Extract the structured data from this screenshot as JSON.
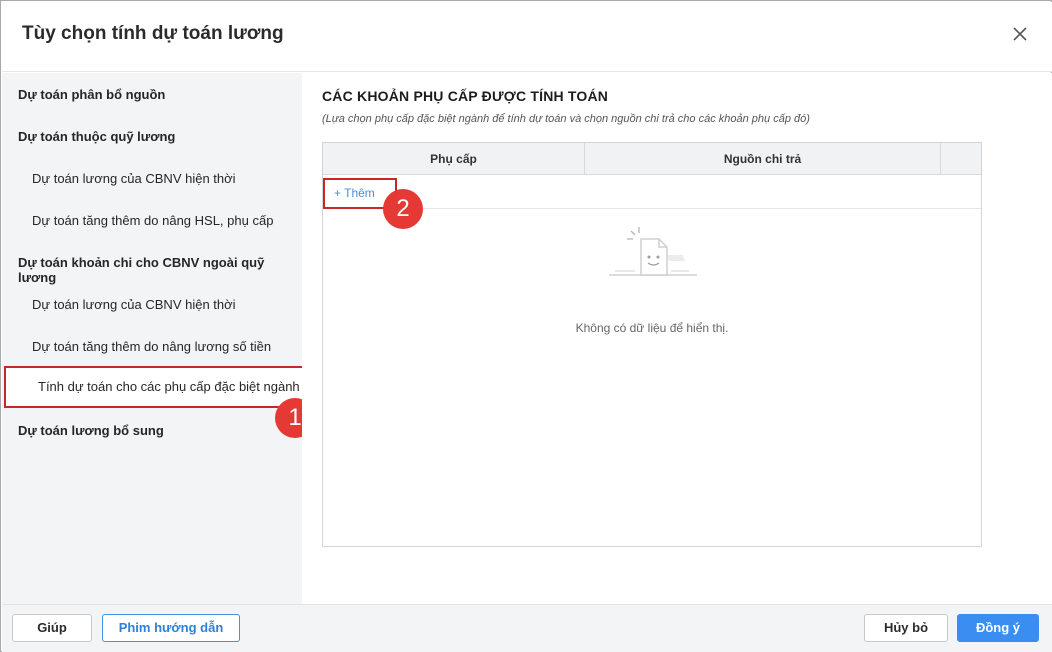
{
  "dialog": {
    "title": "Tùy chọn tính dự toán lương"
  },
  "sidebar": {
    "items": [
      {
        "label": "Dự toán phân bổ nguồn"
      },
      {
        "label": "Dự toán thuộc quỹ lương"
      },
      {
        "label": "Dự toán lương của CBNV hiện thời"
      },
      {
        "label": "Dự toán tăng thêm do nâng HSL, phụ cấp"
      },
      {
        "label": "Dự toán khoản chi cho CBNV ngoài quỹ lương"
      },
      {
        "label": "Dự toán lương của CBNV hiện thời"
      },
      {
        "label": "Dự toán tăng thêm do nâng lương số tiền"
      },
      {
        "label": "Tính dự toán cho các phụ cấp đặc biệt ngành"
      },
      {
        "label": "Dự toán lương bổ sung"
      }
    ]
  },
  "content": {
    "title": "CÁC KHOẢN PHỤ CẤP ĐƯỢC TÍNH TOÁN",
    "note": "(Lựa chọn phụ cấp đặc biệt ngành để tính dự toán và chọn nguồn chi trả cho các khoản phụ cấp đó)",
    "columns": [
      "Phụ cấp",
      "Nguồn chi trả"
    ],
    "add_label": "+ Thêm",
    "empty_text": "Không có dữ liệu để hiển thị."
  },
  "annotations": {
    "badge_1": "1",
    "badge_2": "2"
  },
  "footer": {
    "help": "Giúp",
    "video": "Phim hướng dẫn",
    "cancel": "Hủy bỏ",
    "ok": "Đồng ý"
  },
  "colors": {
    "accent": "#3a8ef2",
    "highlight_border": "#c62828",
    "badge": "#e53935",
    "link": "#4a90d9"
  }
}
